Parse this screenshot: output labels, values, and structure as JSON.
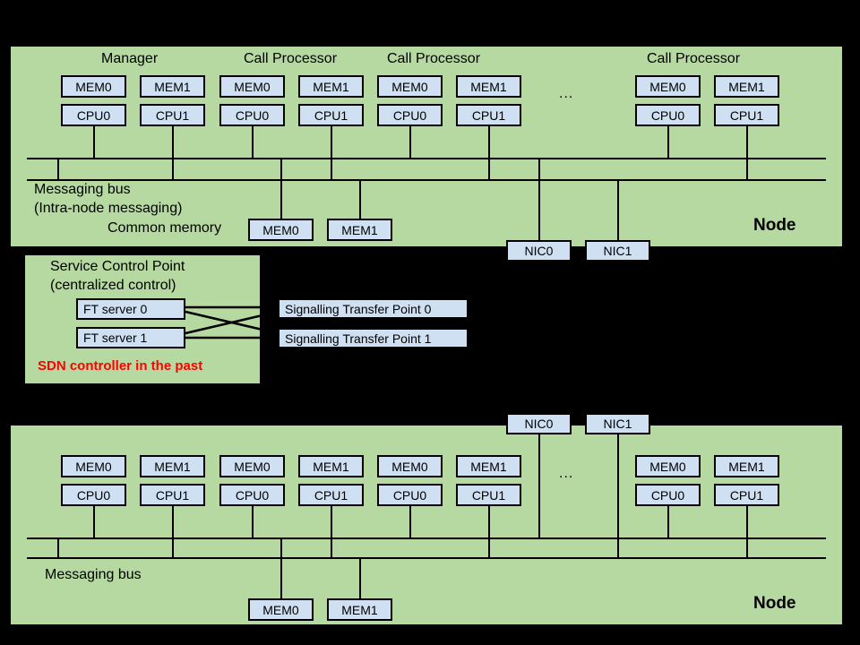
{
  "colors": {
    "background": "#000000",
    "node_fill": "#b5d9a0",
    "box_fill": "#cfe0f3",
    "line": "#000000",
    "accent_red": "#ff0000"
  },
  "top_node": {
    "name": "Node",
    "clusters": [
      {
        "title": "Manager",
        "mem": [
          "MEM0",
          "MEM1"
        ],
        "cpu": [
          "CPU0",
          "CPU1"
        ]
      },
      {
        "title": "Call Processor",
        "mem": [
          "MEM0",
          "MEM1"
        ],
        "cpu": [
          "CPU0",
          "CPU1"
        ]
      },
      {
        "title": "Call Processor",
        "mem": [
          "MEM0",
          "MEM1"
        ],
        "cpu": [
          "CPU0",
          "CPU1"
        ]
      },
      {
        "title": "Call Processor",
        "mem": [
          "MEM0",
          "MEM1"
        ],
        "cpu": [
          "CPU0",
          "CPU1"
        ]
      }
    ],
    "ellipsis": "...",
    "bus_label_line1": "Messaging bus",
    "bus_label_line2": "(Intra-node messaging)",
    "common_memory_label": "Common memory",
    "common_memory": [
      "MEM0",
      "MEM1"
    ],
    "nics": [
      "NIC0",
      "NIC1"
    ]
  },
  "scp": {
    "title_line1": "Service Control Point",
    "title_line2": "(centralized control)",
    "servers": [
      "FT server 0",
      "FT server 1"
    ],
    "note": "SDN controller in the past"
  },
  "stps": [
    "Signalling Transfer Point 0",
    "Signalling Transfer Point 1"
  ],
  "bottom_node": {
    "name": "Node",
    "clusters": [
      {
        "mem": [
          "MEM0",
          "MEM1"
        ],
        "cpu": [
          "CPU0",
          "CPU1"
        ]
      },
      {
        "mem": [
          "MEM0",
          "MEM1"
        ],
        "cpu": [
          "CPU0",
          "CPU1"
        ]
      },
      {
        "mem": [
          "MEM0",
          "MEM1"
        ],
        "cpu": [
          "CPU0",
          "CPU1"
        ]
      },
      {
        "mem": [
          "MEM0",
          "MEM1"
        ],
        "cpu": [
          "CPU0",
          "CPU1"
        ]
      }
    ],
    "ellipsis": "...",
    "bus_label": "Messaging bus",
    "common_memory": [
      "MEM0",
      "MEM1"
    ],
    "nics": [
      "NIC0",
      "NIC1"
    ]
  }
}
